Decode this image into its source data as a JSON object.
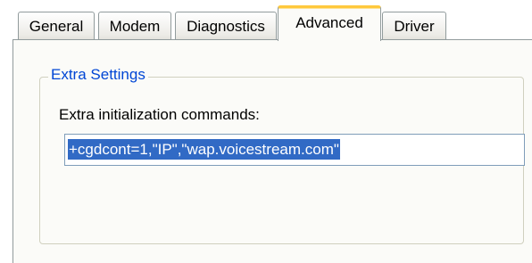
{
  "tabs": [
    {
      "label": "General"
    },
    {
      "label": "Modem"
    },
    {
      "label": "Diagnostics"
    },
    {
      "label": "Advanced",
      "selected": true
    },
    {
      "label": "Driver"
    }
  ],
  "extra_settings": {
    "group_title": "Extra Settings",
    "init_label": "Extra initialization commands:",
    "init_value": "+cgdcont=1,\"IP\",\"wap.voicestream.com\""
  },
  "colors": {
    "selected_tab_accent": "#ffc83c",
    "group_title_text": "#0046d5",
    "selection_highlight": "#316ac5",
    "textbox_border": "#7f9db9"
  }
}
